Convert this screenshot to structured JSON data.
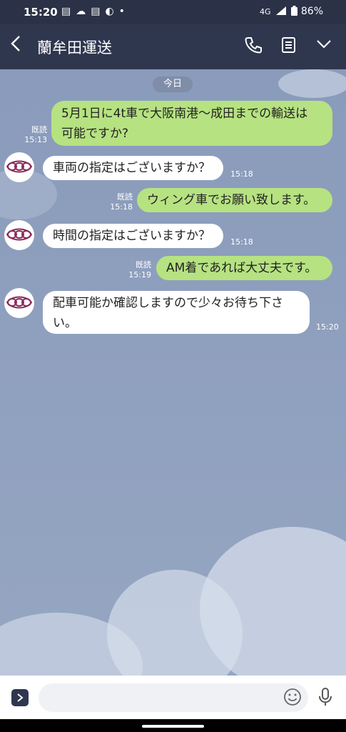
{
  "status_bar": {
    "time": "15:20",
    "network": "4G",
    "battery": "86%"
  },
  "header": {
    "title": "蘭牟田運送"
  },
  "chat": {
    "date_label": "今日",
    "messages": [
      {
        "direction": "out",
        "lines": [
          "5月1日に4t車で大阪南港〜成田までの輸送は",
          "可能ですか?"
        ],
        "read": "既読",
        "time": "15:13"
      },
      {
        "direction": "in",
        "lines": [
          "車両の指定はございますか？"
        ],
        "time": "15:18"
      },
      {
        "direction": "out",
        "lines": [
          "ウィング車でお願い致します。"
        ],
        "read": "既読",
        "time": "15:18"
      },
      {
        "direction": "in",
        "lines": [
          "時間の指定はございますか？"
        ],
        "time": "15:18"
      },
      {
        "direction": "out",
        "lines": [
          "AM着であれば大丈夫です。"
        ],
        "read": "既読",
        "time": "15:19"
      },
      {
        "direction": "in",
        "lines": [
          "配車可能か確認しますので少々お待ち下さ",
          "い。"
        ],
        "time": "15:20"
      }
    ]
  },
  "input": {
    "placeholder": ""
  },
  "icons": {
    "back": "chevron-left-icon",
    "call": "phone-icon",
    "notes": "notes-icon",
    "menu": "chevron-down-icon",
    "expand": "chevron-right-icon",
    "emoji": "emoji-icon",
    "mic": "microphone-icon"
  },
  "colors": {
    "outgoing_bubble": "#b6e281",
    "incoming_bubble": "#ffffff",
    "header": "#2f374f",
    "chat_background": "#8d9fbd"
  }
}
